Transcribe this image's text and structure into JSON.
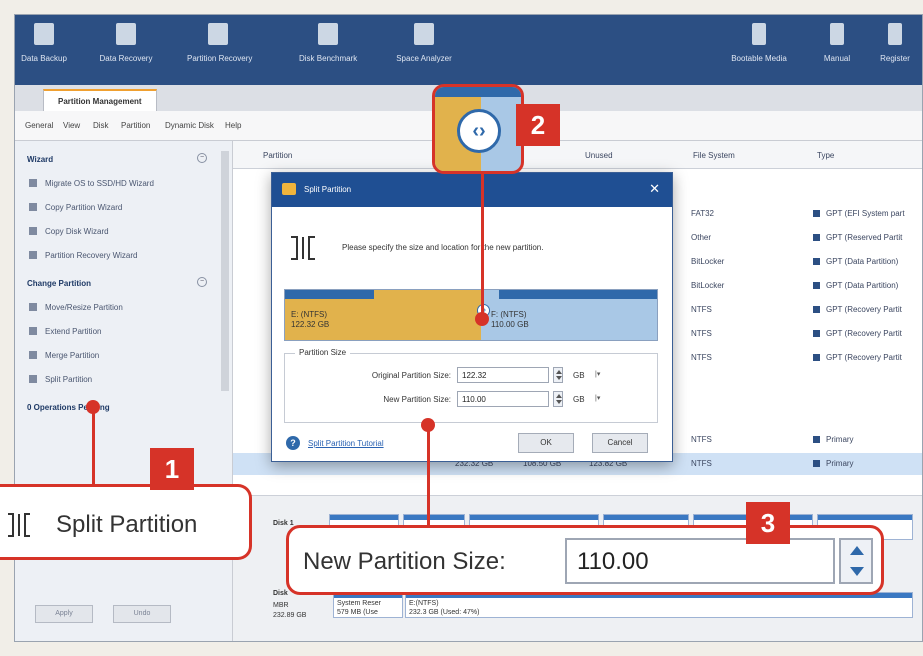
{
  "toolbar": {
    "items": [
      {
        "label": "Data Backup",
        "icon": "data-backup-icon"
      },
      {
        "label": "Data Recovery",
        "icon": "data-recovery-icon"
      },
      {
        "label": "Partition Recovery",
        "icon": "partition-recovery-icon"
      },
      {
        "label": "Disk Benchmark",
        "icon": "disk-benchmark-icon"
      },
      {
        "label": "Space Analyzer",
        "icon": "space-analyzer-icon"
      },
      {
        "label": "Bootable Media",
        "icon": "bootable-media-icon"
      },
      {
        "label": "Manual",
        "icon": "manual-icon"
      },
      {
        "label": "Register",
        "icon": "register-icon"
      }
    ]
  },
  "tabs": {
    "active": "Partition Management"
  },
  "menu": [
    "General",
    "View",
    "Disk",
    "Partition",
    "Dynamic Disk",
    "Help"
  ],
  "sidebar": {
    "wizard_heading": "Wizard",
    "wizard_items": [
      "Migrate OS to SSD/HD Wizard",
      "Copy Partition Wizard",
      "Copy Disk Wizard",
      "Partition Recovery Wizard"
    ],
    "change_heading": "Change Partition",
    "change_items": [
      "Move/Resize Partition",
      "Extend Partition",
      "Merge Partition",
      "Split Partition"
    ],
    "pending": "0 Operations Pending",
    "apply_label": "Apply",
    "undo_label": "Undo"
  },
  "table": {
    "headers": [
      "Partition",
      "Unused",
      "File System",
      "Type"
    ],
    "rows": [
      {
        "fs": "FAT32",
        "type": "GPT (EFI System part"
      },
      {
        "fs": "Other",
        "type": "GPT (Reserved Partit"
      },
      {
        "fs": "BitLocker",
        "type": "GPT (Data Partition)"
      },
      {
        "fs": "BitLocker",
        "type": "GPT (Data Partition)"
      },
      {
        "fs": "NTFS",
        "type": "GPT (Recovery Partit"
      },
      {
        "fs": "NTFS",
        "type": "GPT (Recovery Partit"
      },
      {
        "fs": "NTFS",
        "type": "GPT (Recovery Partit"
      }
    ],
    "lower_rows": [
      {
        "fs": "NTFS",
        "type": "Primary"
      },
      {
        "fs": "NTFS",
        "type": "Primary",
        "c1": "232.32 GB",
        "c2": "108.50 GB",
        "c3": "123.82 GB"
      }
    ]
  },
  "diskmap": {
    "disk1": "Disk 1",
    "disk2": "Disk",
    "mbr": "MBR",
    "size": "232.89 GB",
    "sysres": "System Reser",
    "sysres_sub": "579 MB (Use",
    "epart": "E:(NTFS)",
    "epart_sub": "232.3 GB (Used: 47%)"
  },
  "dialog": {
    "title": "Split Partition",
    "message": "Please specify the size and location for the new partition.",
    "left_part_name": "E: (NTFS)",
    "left_part_size": "122.32 GB",
    "right_part_name": "F: (NTFS)",
    "right_part_size": "110.00 GB",
    "group_title": "Partition Size",
    "orig_label": "Original Partition Size:",
    "orig_value": "122.32",
    "new_label": "New Partition Size:",
    "new_value": "110.00",
    "unit": "GB",
    "tutorial_link": "Split Partition Tutorial",
    "ok_label": "OK",
    "cancel_label": "Cancel"
  },
  "callouts": {
    "badge1": "1",
    "badge2": "2",
    "badge3": "3",
    "zoom1_text": "Split Partition",
    "zoom3_label": "New Partition Size:",
    "zoom3_value": "110.00"
  },
  "colors": {
    "accent_red": "#d63328",
    "toolbar_blue": "#2c4f83",
    "left_partition": "#e1b24c",
    "right_partition": "#a9c8e6"
  },
  "split_fraction": 0.53
}
